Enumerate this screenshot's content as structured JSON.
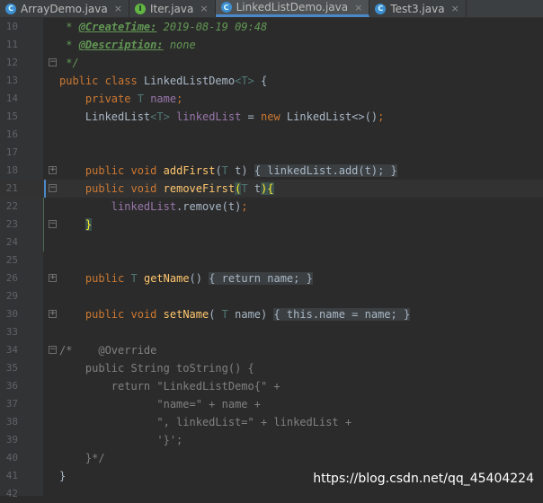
{
  "tabs": [
    {
      "label": "ArrayDemo.java",
      "icon": "class-icon",
      "active": false
    },
    {
      "label": "Iter.java",
      "icon": "interface-icon",
      "active": false
    },
    {
      "label": "LinkedListDemo.java",
      "icon": "class-icon",
      "active": true
    },
    {
      "label": "Test3.java",
      "icon": "class-icon",
      "active": false
    }
  ],
  "close_glyph": "×",
  "icon_letters": {
    "class": "C",
    "interface": "I"
  },
  "line_numbers": [
    "10",
    "11",
    "12",
    "13",
    "14",
    "15",
    "16",
    "17",
    "18",
    "21",
    "22",
    "23",
    "24",
    "25",
    "26",
    "29",
    "30",
    "33",
    "34",
    "35",
    "36",
    "37",
    "38",
    "39",
    "40",
    "41",
    "42"
  ],
  "code": {
    "l10_star": " * ",
    "l10_tag": "@CreateTime:",
    "l10_rest": " 2019-08-19 09:48",
    "l11_star": " * ",
    "l11_tag": "@Description:",
    "l11_rest": " none",
    "l12": " */",
    "l13_kw1": "public",
    "l13_kw2": "class",
    "l13_name": "LinkedListDemo",
    "l13_tp": "<T>",
    "l13_brace": " {",
    "l14_kw": "private",
    "l14_tp": "T",
    "l14_fld": "name",
    "l14_semi": ";",
    "l15_type": "LinkedList",
    "l15_tp": "<T>",
    "l15_fld": "linkedList",
    "l15_eq": " = ",
    "l15_new": "new",
    "l15_rest": " LinkedList<>()",
    "l15_semi": ";",
    "l18_kw1": "public",
    "l18_kw2": "void",
    "l18_fn": "addFirst",
    "l18_p1": "(",
    "l18_tp": "T",
    "l18_p2": " t) ",
    "l18_chip": "{ linkedList.add(t); }",
    "l21_kw1": "public",
    "l21_kw2": "void",
    "l21_fn": "removeFirst",
    "l21_paren": "(",
    "l21_tp": "T",
    "l21_t": " t",
    "l21_close": ")",
    "l21_brace": "{",
    "l22_fld": "linkedList",
    "l22_rest": ".remove(t)",
    "l22_semi": ";",
    "l23_brace": "}",
    "l26_kw": "public",
    "l26_tp": "T",
    "l26_fn": "getName",
    "l26_p": "() ",
    "l26_chip": "{ return name; }",
    "l30_kw1": "public",
    "l30_kw2": "void",
    "l30_fn": "setName",
    "l30_p1": "( ",
    "l30_tp": "T",
    "l30_p2": " name) ",
    "l30_chip": "{ this.name = name; }",
    "l34": "/*    @Override",
    "l35": "    public String toString() {",
    "l36": "        return \"LinkedListDemo{\" +",
    "l37": "               \"name=\" + name +",
    "l38": "               \", linkedList=\" + linkedList +",
    "l39": "               '}';",
    "l40": "    }*/",
    "l41": "}"
  },
  "colors": {
    "keyword": "#cc7832",
    "comment": "#808080",
    "doc": "#629755",
    "field": "#9876aa",
    "function": "#ffc66d",
    "accent": "#4a88c7"
  },
  "watermark": "https://blog.csdn.net/qq_45404224"
}
